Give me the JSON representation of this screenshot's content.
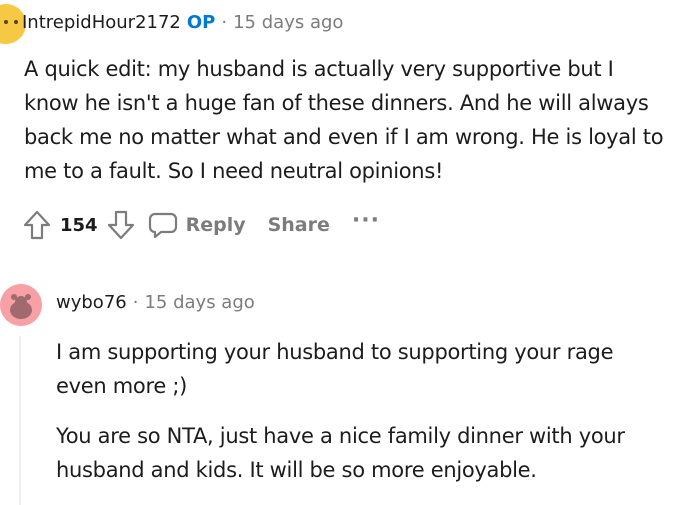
{
  "comment1": {
    "author": "IntrepidHour2172",
    "op_badge": "OP",
    "separator": "·",
    "time": "15 days ago",
    "lines": [
      "A quick edit: my husband is actually very supportive but I",
      "know he isn't a huge fan of these dinners. And he will always",
      "back me no matter what and even if I am wrong. He is loyal to",
      "me to a fault. So I need neutral opinions!"
    ],
    "votes": "154",
    "reply_label": "Reply",
    "share_label": "Share",
    "more_label": "···",
    "icons": [
      "upvote-icon",
      "downvote-icon",
      "comment-bubble-icon"
    ]
  },
  "comment2": {
    "author": "wybo76",
    "separator": "·",
    "time": "15 days ago",
    "paragraphs": [
      {
        "lines": [
          "I am supporting your husband to supporting your rage",
          "even more ;)"
        ]
      },
      {
        "lines": [
          "You are so NTA, just have a nice family dinner with your",
          "husband and kids. It will be so more enjoyable."
        ]
      }
    ]
  },
  "colors": {
    "op_blue": "#0079d3",
    "meta_gray": "#7c7c7c",
    "avatar1": "#f7c843",
    "avatar2": "#f7a1a7"
  }
}
